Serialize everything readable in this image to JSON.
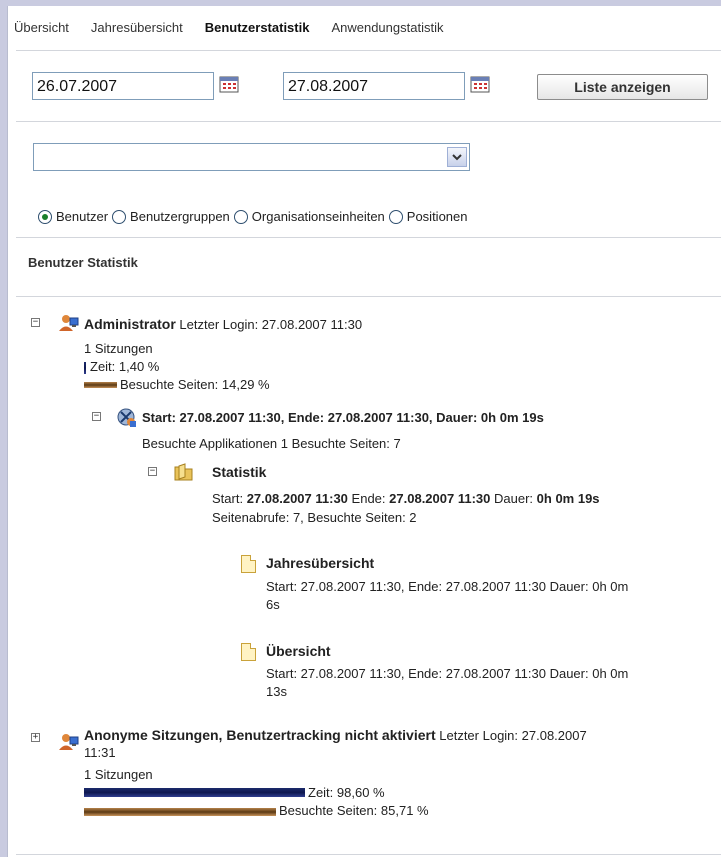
{
  "tabs": [
    {
      "label": "Übersicht"
    },
    {
      "label": "Jahresübersicht"
    },
    {
      "label": "Benutzerstatistik"
    },
    {
      "label": "Anwendungstatistik"
    }
  ],
  "filters": {
    "date_from": "26.07.2007",
    "date_to": "27.08.2007",
    "show_list_label": "Liste anzeigen",
    "select_value": "",
    "radios": [
      {
        "label": "Benutzer",
        "selected": true
      },
      {
        "label": "Benutzergruppen",
        "selected": false
      },
      {
        "label": "Organisationseinheiten",
        "selected": false
      },
      {
        "label": "Positionen",
        "selected": false
      }
    ]
  },
  "section_title": "Benutzer Statistik",
  "users": [
    {
      "name": "Administrator",
      "last_login_label": "Letzter Login: 27.08.2007 11:30",
      "sessions": "1 Sitzungen",
      "time_label": "Zeit: 1,40 %",
      "time_value": 1.4,
      "pages_label": "Besuchte Seiten: 14,29 %",
      "pages_value": 14.29,
      "session": {
        "title": "Start: 27.08.2007 11:30, Ende: 27.08.2007 11:30, Dauer: 0h 0m 19s",
        "summary": "Besuchte Applikationen 1 Besuchte Seiten: 7",
        "app": {
          "name": "Statistik",
          "start_label": "Start:",
          "start": "27.08.2007 11:30",
          "end_label": "Ende:",
          "end": "27.08.2007 11:30",
          "duration_label": "Dauer:",
          "duration": "0h 0m 19s",
          "calls": "Seitenabrufe: 7, Besuchte Seiten: 2",
          "pages": [
            {
              "name": "Jahresübersicht",
              "line1": "Start: 27.08.2007 11:30, Ende: 27.08.2007 11:30 Dauer: 0h 0m",
              "line2": "6s"
            },
            {
              "name": "Übersicht",
              "line1": "Start: 27.08.2007 11:30, Ende: 27.08.2007 11:30 Dauer: 0h 0m",
              "line2": "13s"
            }
          ]
        }
      }
    },
    {
      "name": "Anonyme Sitzungen, Benutzertracking nicht aktiviert",
      "last_login_label": "Letzter Login: 27.08.2007",
      "last_login_cont": "11:31",
      "sessions": "1 Sitzungen",
      "time_label": "Zeit: 98,60 %",
      "time_value": 98.6,
      "pages_label": "Besuchte Seiten: 85,71 %",
      "pages_value": 85.71
    }
  ],
  "toggles": {
    "expanded": "−",
    "collapsed": "+"
  }
}
